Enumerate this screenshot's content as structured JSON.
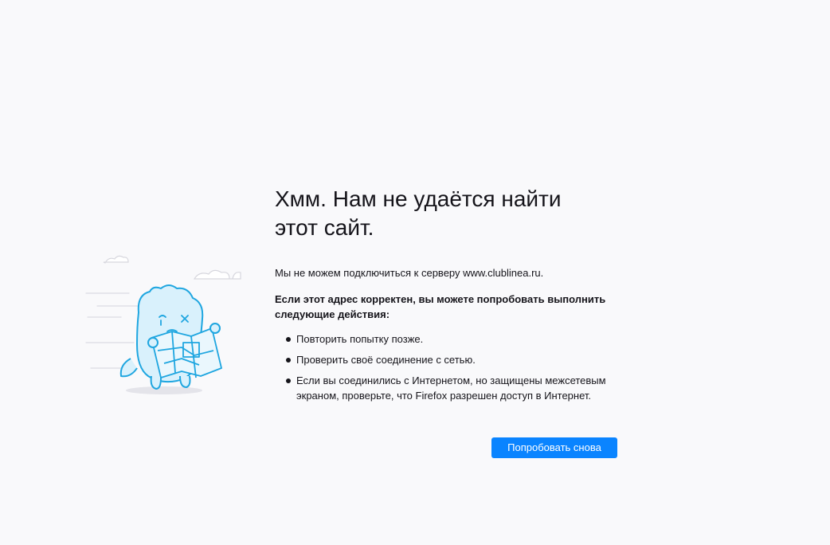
{
  "error": {
    "title": "Хмм. Нам не удаётся найти этот сайт.",
    "intro": "Мы не можем подключиться к серверу www.clublinea.ru.",
    "advice_heading": "Если этот адрес корректен, вы можете попробовать выполнить следующие действия:",
    "advice_items": [
      "Повторить попытку позже.",
      "Проверить своё соединение с сетью.",
      "Если вы соединились с Интернетом, но защищены межсетевым экраном, проверьте, что Firefox разрешен доступ в Интернет."
    ],
    "retry_label": "Попробовать снова"
  },
  "colors": {
    "background": "#f9f9fb",
    "accent": "#0a84ff",
    "illustration_stroke": "#1fa6e0",
    "illustration_fill": "#d9f1fc"
  },
  "illustration": {
    "icon": "confused-monster-with-map-icon"
  }
}
